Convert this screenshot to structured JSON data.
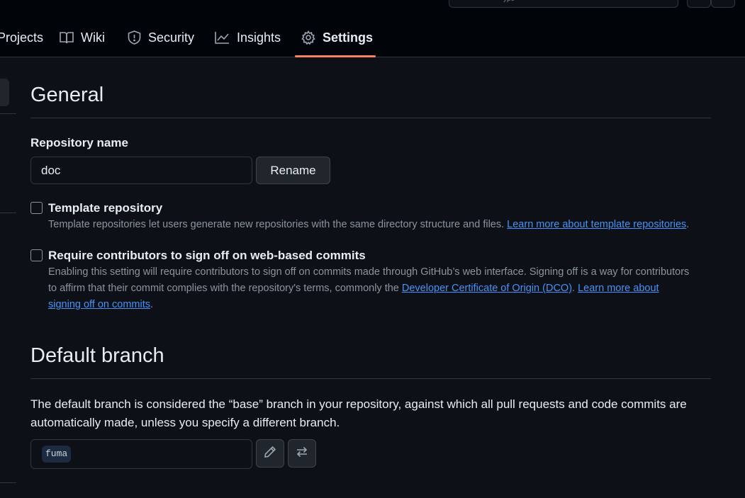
{
  "nav": {
    "tabs": [
      {
        "label": "Projects",
        "icon": "table-icon"
      },
      {
        "label": "Wiki",
        "icon": "book-icon"
      },
      {
        "label": "Security",
        "icon": "shield-icon"
      },
      {
        "label": "Insights",
        "icon": "graph-icon"
      },
      {
        "label": "Settings",
        "icon": "gear-icon",
        "active": true
      }
    ],
    "search_glyph": "ype"
  },
  "general": {
    "heading": "General",
    "repo_name_label": "Repository name",
    "repo_name_value": "doc",
    "rename_label": "Rename",
    "template": {
      "title": "Template repository",
      "desc": "Template repositories let users generate new repositories with the same directory structure and files.",
      "link": "Learn more about template repositories",
      "after_link": ".",
      "checked": false
    },
    "signoff": {
      "title": "Require contributors to sign off on web-based commits",
      "desc": "Enabling this setting will require contributors to sign off on commits made through GitHub’s web interface. Signing off is a way for contributors to affirm that their commit complies with the repository's terms, commonly the",
      "link1": "Developer Certificate of Origin (DCO)",
      "sep": ".",
      "link2": "Learn more about signing off on commits",
      "after_link": ".",
      "checked": false
    }
  },
  "default_branch": {
    "heading": "Default branch",
    "desc": "The default branch is considered the “base” branch in your repository, against which all pull requests and code commits are automatically made, unless you specify a different branch.",
    "branch": "fuma"
  },
  "colors": {
    "background": "#0d1117",
    "header": "#010409",
    "accent_underline": "#f78166",
    "link": "#4493f8"
  }
}
